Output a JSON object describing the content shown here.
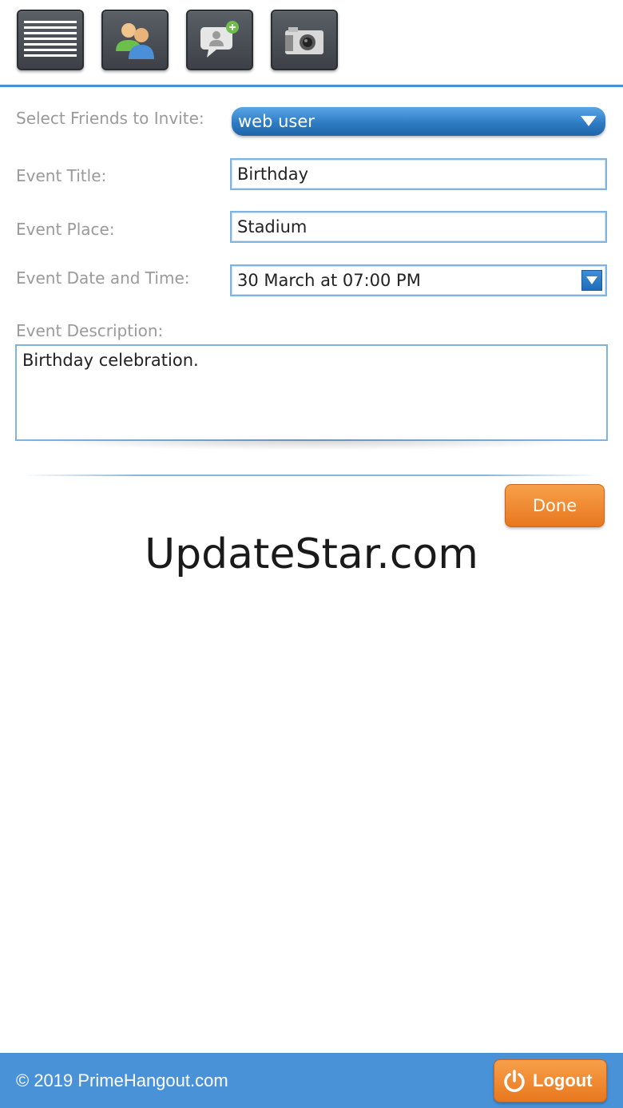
{
  "toolbar": {
    "buttons": [
      {
        "icon": "menu-icon"
      },
      {
        "icon": "friends-icon"
      },
      {
        "icon": "add-chat-icon"
      },
      {
        "icon": "camera-icon"
      }
    ]
  },
  "form": {
    "friends_label": "Select Friends to Invite:",
    "friends_value": "web user",
    "title_label": "Event Title:",
    "title_value": "Birthday",
    "place_label": "Event Place:",
    "place_value": "Stadium",
    "datetime_label": "Event Date and Time:",
    "datetime_value": "30 March at 07:00 PM",
    "description_label": "Event Description:",
    "description_value": "Birthday celebration.",
    "done_label": "Done"
  },
  "watermark": "UpdateStar.com",
  "footer": {
    "copyright": "© 2019 PrimeHangout.com",
    "logout_label": "Logout"
  },
  "colors": {
    "accent_blue": "#4a92d8",
    "button_orange": "#e8771e",
    "label_gray": "#9a9a9a"
  }
}
